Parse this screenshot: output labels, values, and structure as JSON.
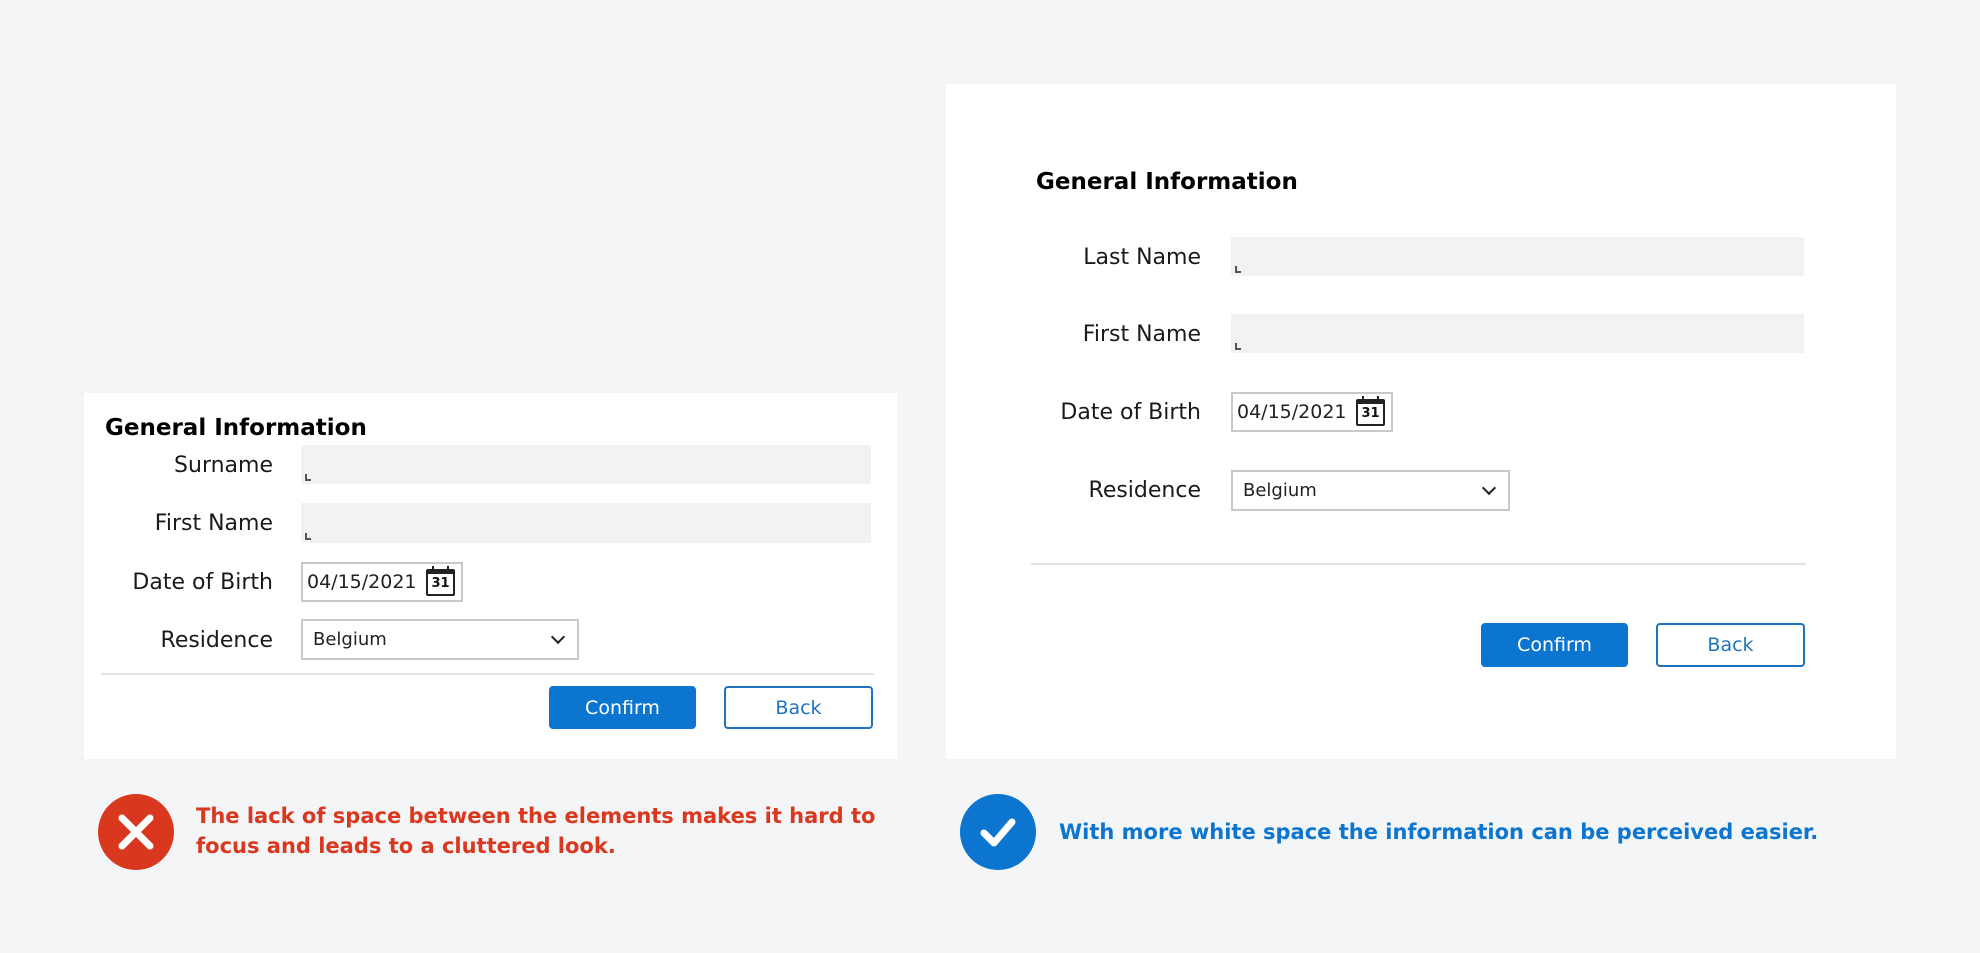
{
  "colors": {
    "background": "#f4f5f7",
    "primary": "#0b75cf",
    "bad": "#d9381e",
    "good": "#0b75cf"
  },
  "bad_example": {
    "title": "General Information",
    "fields": {
      "surname_label": "Surname",
      "firstname_label": "First Name",
      "dob_label": "Date of Birth",
      "dob_value": "04/15/2021",
      "calendar_day": "31",
      "residence_label": "Residence",
      "residence_value": "Belgium"
    },
    "buttons": {
      "confirm": "Confirm",
      "back": "Back"
    },
    "icon": "close-icon",
    "caption": "The lack of space between the elements makes it hard to focus and leads to a cluttered look."
  },
  "good_example": {
    "title": "General Information",
    "fields": {
      "lastname_label": "Last Name",
      "firstname_label": "First Name",
      "dob_label": "Date of Birth",
      "dob_value": "04/15/2021",
      "calendar_day": "31",
      "residence_label": "Residence",
      "residence_value": "Belgium"
    },
    "buttons": {
      "confirm": "Confirm",
      "back": "Back"
    },
    "icon": "checkmark-icon",
    "caption": "With more white space the information can be perceived easier."
  }
}
